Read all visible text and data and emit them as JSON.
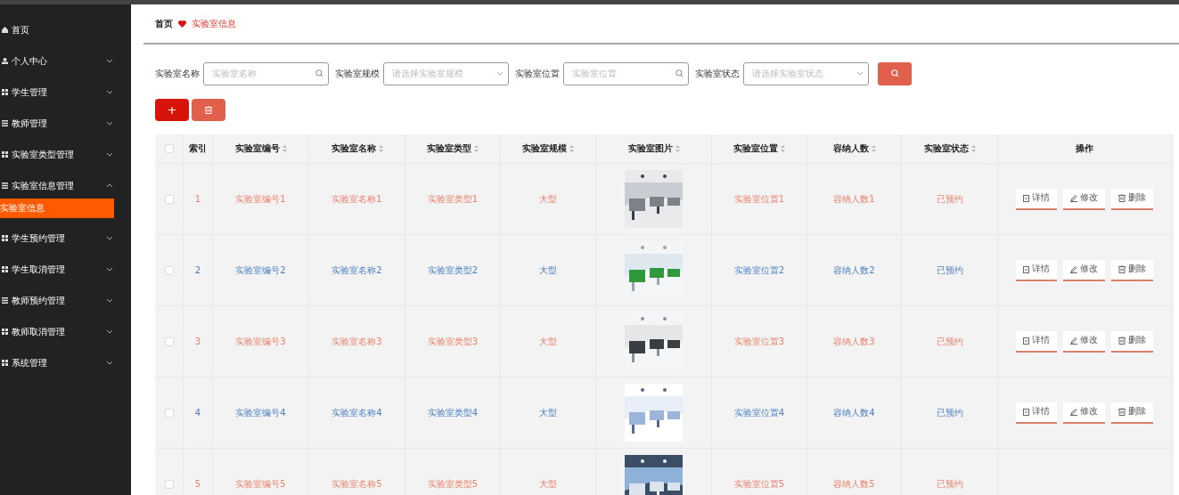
{
  "sidebar": {
    "items": [
      {
        "label": "首页"
      },
      {
        "label": "个人中心",
        "expanded": false
      },
      {
        "label": "学生管理",
        "expanded": false
      },
      {
        "label": "教师管理",
        "expanded": false
      },
      {
        "label": "实验室类型管理",
        "expanded": false
      },
      {
        "label": "实验室信息管理",
        "expanded": true,
        "children": [
          {
            "label": "实验室信息",
            "selected": true
          }
        ]
      },
      {
        "label": "学生预约管理",
        "expanded": false
      },
      {
        "label": "学生取消管理",
        "expanded": false
      },
      {
        "label": "教师预约管理",
        "expanded": false
      },
      {
        "label": "教师取消管理",
        "expanded": false
      },
      {
        "label": "系统管理",
        "expanded": false
      }
    ]
  },
  "breadcrumb": [
    "首页",
    "实验室信息"
  ],
  "search": {
    "filters": [
      {
        "label": "实验室名称",
        "placeholder": "实验室名称",
        "kind": "text"
      },
      {
        "label": "实验室规模",
        "placeholder": "请选择实验室规模",
        "kind": "select"
      },
      {
        "label": "实验室位置",
        "placeholder": "实验室位置",
        "kind": "text"
      },
      {
        "label": "实验室状态",
        "placeholder": "请选择实验室状态",
        "kind": "select"
      }
    ]
  },
  "toolbar": {
    "add": "+"
  },
  "table": {
    "all_checked": false,
    "columns": [
      {
        "label": "索引",
        "sortable": false
      },
      {
        "label": "实验室编号",
        "sortable": true
      },
      {
        "label": "实验室名称",
        "sortable": true
      },
      {
        "label": "实验室类型",
        "sortable": true
      },
      {
        "label": "实验室规模",
        "sortable": true
      },
      {
        "label": "实验室图片",
        "sortable": true
      },
      {
        "label": "实验室位置",
        "sortable": true
      },
      {
        "label": "容纳人数",
        "sortable": true
      },
      {
        "label": "实验室状态",
        "sortable": true
      },
      {
        "label": "操作",
        "sortable": false
      }
    ],
    "rows": [
      {
        "index": "1",
        "code": "实验室编号1",
        "name": "实验室名称1",
        "type": "实验室类型1",
        "scale": "大型",
        "location": "实验室位置1",
        "capacity": "容纳人数1",
        "status": "已预约",
        "color": "#e8826b",
        "checked": false,
        "actions": [
          "详情",
          "修改",
          "删除"
        ]
      },
      {
        "index": "2",
        "code": "实验室编号2",
        "name": "实验室名称2",
        "type": "实验室类型2",
        "scale": "大型",
        "location": "实验室位置2",
        "capacity": "容纳人数2",
        "status": "已预约",
        "color": "#4a80c0",
        "checked": false,
        "actions": [
          "详情",
          "修改",
          "删除"
        ]
      },
      {
        "index": "3",
        "code": "实验室编号3",
        "name": "实验室名称3",
        "type": "实验室类型3",
        "scale": "大型",
        "location": "实验室位置3",
        "capacity": "容纳人数3",
        "status": "已预约",
        "color": "#e8826b",
        "checked": false,
        "actions": [
          "详情",
          "修改",
          "删除"
        ]
      },
      {
        "index": "4",
        "code": "实验室编号4",
        "name": "实验室名称4",
        "type": "实验室类型4",
        "scale": "大型",
        "location": "实验室位置4",
        "capacity": "容纳人数4",
        "status": "已预约",
        "color": "#4a80c0",
        "checked": false,
        "actions": [
          "详情",
          "修改",
          "删除"
        ]
      },
      {
        "index": "5",
        "code": "实验室编号5",
        "name": "实验室名称5",
        "type": "实验室类型5",
        "scale": "大型",
        "location": "实验室位置5",
        "capacity": "容纳人数5",
        "status": "已预约",
        "color": "#e8826b",
        "checked": false
      }
    ]
  }
}
